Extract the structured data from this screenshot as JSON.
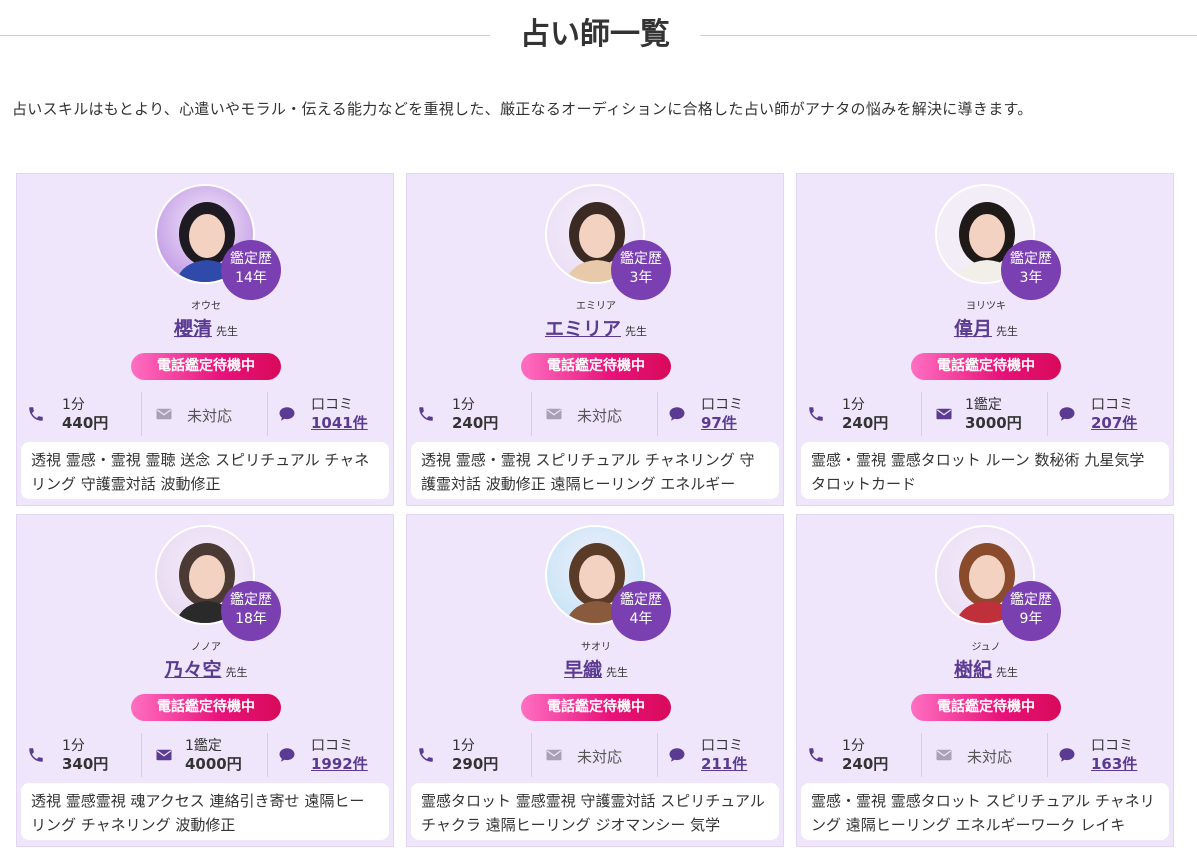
{
  "page": {
    "title": "占い師一覧",
    "intro": "占いスキルはもとより、心遣いやモラル・伝える能力などを重視した、厳正なるオーディションに合格した占い師がアナタの悩みを解決に導きます。"
  },
  "labels": {
    "exp_prefix": "鑑定歴",
    "sensei": "先生",
    "status": "電話鑑定待機中",
    "minute": "1分",
    "mail_unit": "1鑑定",
    "not_supported": "未対応",
    "review": "口コミ"
  },
  "colors": {
    "card_bg": "#efe6fb",
    "name": "#5b3b91",
    "badge": "#7a3fb0",
    "status_from": "#ff6fc2",
    "status_to": "#d80a5a",
    "icon": "#5b3b91"
  },
  "icons": {
    "phone": "phone-icon",
    "mail": "mail-icon",
    "review": "chat-bubble-icon"
  },
  "cards": [
    {
      "kana": "オウセ",
      "name": "櫻清",
      "years": "14年",
      "phone_price": "440円",
      "mail": "未対応",
      "mail_price": "",
      "reviews": "1041件",
      "tags": "透視 霊感・霊視 霊聴 送念 スピリチュアル チャネリング 守護霊対話 波動修正"
    },
    {
      "kana": "エミリア",
      "name": "エミリア",
      "years": "3年",
      "phone_price": "240円",
      "mail": "未対応",
      "mail_price": "",
      "reviews": "97件",
      "tags": "透視 霊感・霊視 スピリチュアル チャネリング 守護霊対話 波動修正 遠隔ヒーリング エネルギー"
    },
    {
      "kana": "ヨリツキ",
      "name": "偉月",
      "years": "3年",
      "phone_price": "240円",
      "mail": "1鑑定",
      "mail_price": "3000円",
      "reviews": "207件",
      "tags": "霊感・霊視 霊感タロット ルーン 数秘術 九星気学 タロットカード"
    },
    {
      "kana": "ノノア",
      "name": "乃々空",
      "years": "18年",
      "phone_price": "340円",
      "mail": "1鑑定",
      "mail_price": "4000円",
      "reviews": "1992件",
      "tags": "透視 霊感霊視 魂アクセス 連絡引き寄せ 遠隔ヒーリング チャネリング 波動修正"
    },
    {
      "kana": "サオリ",
      "name": "早織",
      "years": "4年",
      "phone_price": "290円",
      "mail": "未対応",
      "mail_price": "",
      "reviews": "211件",
      "tags": "霊感タロット 霊感霊視 守護霊対話 スピリチュアル チャクラ 遠隔ヒーリング ジオマンシー 気学"
    },
    {
      "kana": "ジュノ",
      "name": "樹紀",
      "years": "9年",
      "phone_price": "240円",
      "mail": "未対応",
      "mail_price": "",
      "reviews": "163件",
      "tags": "霊感・霊視 霊感タロット スピリチュアル チャネリング 遠隔ヒーリング エネルギーワーク レイキ"
    }
  ]
}
